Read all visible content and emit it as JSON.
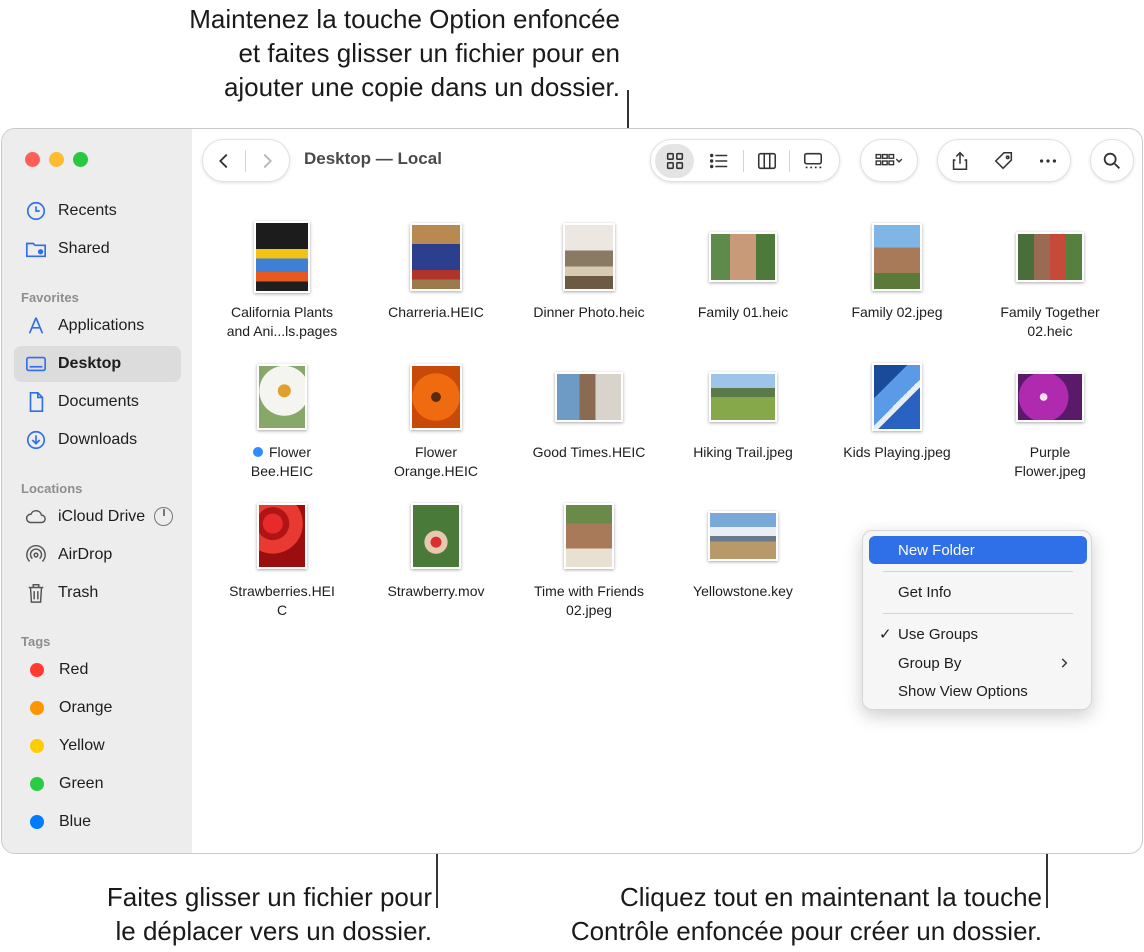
{
  "callouts": {
    "top": [
      "Maintenez la touche Option enfoncée",
      "et faites glisser un fichier pour en",
      "ajouter une copie dans un dossier."
    ],
    "bottom_left": [
      "Faites glisser un fichier pour",
      "le déplacer vers un dossier."
    ],
    "bottom_right": [
      "Cliquez tout en maintenant la touche",
      "Contrôle enfoncée pour créer un dossier."
    ]
  },
  "window": {
    "title": "Desktop — Local"
  },
  "sidebar": {
    "top_items": [
      {
        "label": "Recents",
        "icon": "clock-icon"
      },
      {
        "label": "Shared",
        "icon": "shared-folder-icon"
      }
    ],
    "favorites_header": "Favorites",
    "favorites": [
      {
        "label": "Applications",
        "icon": "applications-icon"
      },
      {
        "label": "Desktop",
        "icon": "desktop-icon",
        "active": true
      },
      {
        "label": "Documents",
        "icon": "document-icon"
      },
      {
        "label": "Downloads",
        "icon": "download-icon"
      }
    ],
    "locations_header": "Locations",
    "locations": [
      {
        "label": "iCloud Drive",
        "icon": "cloud-icon"
      },
      {
        "label": "AirDrop",
        "icon": "airdrop-icon"
      },
      {
        "label": "Trash",
        "icon": "trash-icon"
      }
    ],
    "tags_header": "Tags",
    "tags": [
      {
        "label": "Red",
        "color": "#ff3b30"
      },
      {
        "label": "Orange",
        "color": "#ff9500"
      },
      {
        "label": "Yellow",
        "color": "#ffcc00"
      },
      {
        "label": "Green",
        "color": "#28cd41"
      },
      {
        "label": "Blue",
        "color": "#007aff"
      }
    ]
  },
  "files": [
    {
      "name_lines": [
        "California Plants",
        "and Ani...ls.pages"
      ]
    },
    {
      "name_lines": [
        "Charreria.HEIC"
      ]
    },
    {
      "name_lines": [
        "Dinner Photo.heic"
      ]
    },
    {
      "name_lines": [
        "Family 01.heic"
      ]
    },
    {
      "name_lines": [
        "Family 02.jpeg"
      ]
    },
    {
      "name_lines": [
        "Family Together",
        "02.heic"
      ]
    },
    {
      "name_lines": [
        "Flower",
        "Bee.HEIC"
      ],
      "tag_color": "#2f8cff"
    },
    {
      "name_lines": [
        "Flower",
        "Orange.HEIC"
      ]
    },
    {
      "name_lines": [
        "Good Times.HEIC"
      ]
    },
    {
      "name_lines": [
        "Hiking Trail.jpeg"
      ]
    },
    {
      "name_lines": [
        "Kids Playing.jpeg"
      ]
    },
    {
      "name_lines": [
        "Purple",
        "Flower.jpeg"
      ]
    },
    {
      "name_lines": [
        "Strawberries.HEI",
        "C"
      ]
    },
    {
      "name_lines": [
        "Strawberry.mov"
      ]
    },
    {
      "name_lines": [
        "Time with Friends",
        "02.jpeg"
      ]
    },
    {
      "name_lines": [
        "Yellowstone.key"
      ]
    }
  ],
  "context_menu": {
    "new_folder": "New Folder",
    "get_info": "Get Info",
    "use_groups": "Use Groups",
    "group_by": "Group By",
    "show_view_options": "Show View Options"
  },
  "colors": {
    "accent": "#2f6fe8",
    "traffic_red": "#ff5f57",
    "traffic_yellow": "#febc2e",
    "traffic_green": "#28c840",
    "sidebar_bg": "#ededed"
  }
}
